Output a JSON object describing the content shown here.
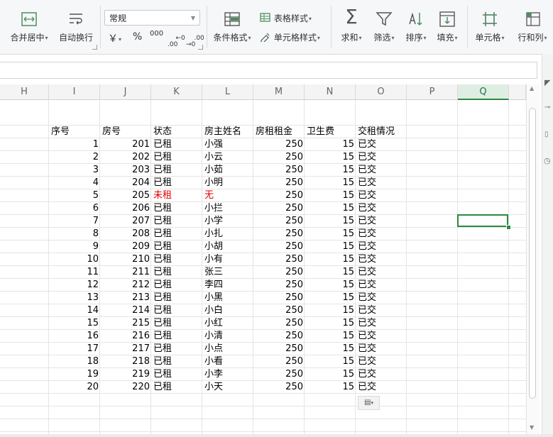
{
  "ribbon": {
    "merge_center": "合并居中",
    "wrap_text": "自动换行",
    "number_format": "常规",
    "currency_symbol": "￥",
    "percent_symbol": "%",
    "thousands_symbol": "000",
    "inc_decimal": "←0\n.00",
    "dec_decimal": ".00\n→0",
    "conditional_format": "条件格式",
    "table_style": "表格样式",
    "cell_style": "单元格样式",
    "sum": "求和",
    "filter": "筛选",
    "sort": "排序",
    "fill": "填充",
    "cell": "单元格",
    "row_col": "行和列"
  },
  "formula_bar": {
    "value": ""
  },
  "columns": [
    "H",
    "I",
    "J",
    "K",
    "L",
    "M",
    "N",
    "O",
    "P",
    "Q"
  ],
  "selected_column": "Q",
  "table": {
    "headers": [
      "序号",
      "房号",
      "状态",
      "房主姓名",
      "房租租金",
      "卫生费",
      "交租情况"
    ],
    "rows": [
      [
        "1",
        "201",
        "已租",
        "小强",
        "250",
        "15",
        "已交"
      ],
      [
        "2",
        "202",
        "已租",
        "小云",
        "250",
        "15",
        "已交"
      ],
      [
        "3",
        "203",
        "已租",
        "小茹",
        "250",
        "15",
        "已交"
      ],
      [
        "4",
        "204",
        "已租",
        "小明",
        "250",
        "15",
        "已交"
      ],
      [
        "5",
        "205",
        "未租",
        "无",
        "250",
        "15",
        "已交"
      ],
      [
        "6",
        "206",
        "已租",
        "小拦",
        "250",
        "15",
        "已交"
      ],
      [
        "7",
        "207",
        "已租",
        "小学",
        "250",
        "15",
        "已交"
      ],
      [
        "8",
        "208",
        "已租",
        "小扎",
        "250",
        "15",
        "已交"
      ],
      [
        "9",
        "209",
        "已租",
        "小胡",
        "250",
        "15",
        "已交"
      ],
      [
        "10",
        "210",
        "已租",
        "小有",
        "250",
        "15",
        "已交"
      ],
      [
        "11",
        "211",
        "已租",
        "张三",
        "250",
        "15",
        "已交"
      ],
      [
        "12",
        "212",
        "已租",
        "李四",
        "250",
        "15",
        "已交"
      ],
      [
        "13",
        "213",
        "已租",
        "小黑",
        "250",
        "15",
        "已交"
      ],
      [
        "14",
        "214",
        "已租",
        "小白",
        "250",
        "15",
        "已交"
      ],
      [
        "15",
        "215",
        "已租",
        "小红",
        "250",
        "15",
        "已交"
      ],
      [
        "16",
        "216",
        "已租",
        "小清",
        "250",
        "15",
        "已交"
      ],
      [
        "17",
        "217",
        "已租",
        "小点",
        "250",
        "15",
        "已交"
      ],
      [
        "18",
        "218",
        "已租",
        "小看",
        "250",
        "15",
        "已交"
      ],
      [
        "19",
        "219",
        "已租",
        "小李",
        "250",
        "15",
        "已交"
      ],
      [
        "20",
        "220",
        "已租",
        "小天",
        "250",
        "15",
        "已交"
      ]
    ],
    "highlight_row_index": 4,
    "highlight_color": "#e00000"
  },
  "colors": {
    "accent": "#2b8a3e",
    "icon": "#4a8f5f"
  }
}
